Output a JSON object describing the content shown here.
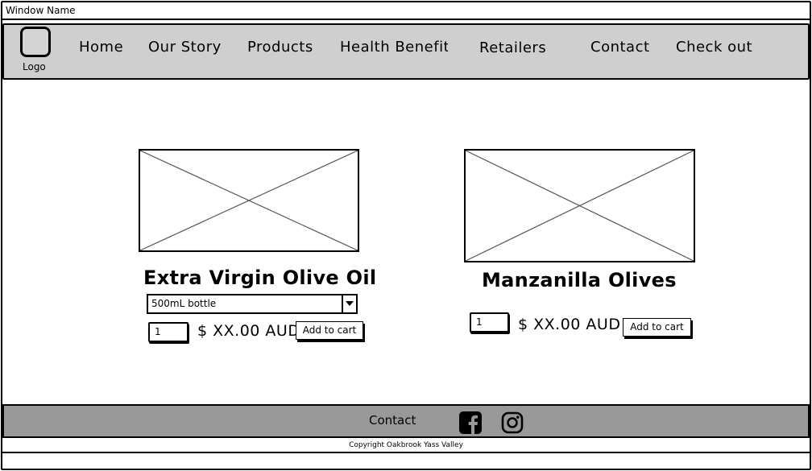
{
  "window": {
    "title": "Window Name"
  },
  "nav": {
    "logo_label": "Logo",
    "items": [
      "Home",
      "Our Story",
      "Products",
      "Health Benefits",
      "Retailers",
      "Contact",
      "Check out"
    ]
  },
  "products": [
    {
      "name": "Extra Virgin Olive Oil",
      "option": "500mL bottle",
      "quantity": "1",
      "price": "$ XX.00 AUD",
      "add_label": "Add to cart"
    },
    {
      "name": "Manzanilla Olives",
      "quantity": "1",
      "price": "$ XX.00 AUD",
      "add_label": "Add to cart"
    }
  ],
  "footer": {
    "contact": "Contact",
    "icons": [
      "facebook-icon",
      "instagram-icon"
    ],
    "copyright": "Copyright Oakbrook Yass Valley"
  },
  "colors": {
    "nav_bg": "#cfcfcf",
    "footer_bg": "#999999"
  }
}
